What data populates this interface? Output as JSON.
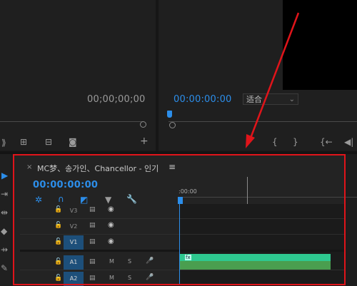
{
  "source_monitor": {
    "timecode": "00;00;00;00",
    "buttons": [
      "insert-icon",
      "overwrite-icon",
      "export-frame-icon",
      "add-icon"
    ]
  },
  "program_monitor": {
    "timecode": "00:00:00:00",
    "fit_label": "适合",
    "controls": [
      "mark-in-icon",
      "mark-out-icon",
      "go-to-in-icon",
      "step-back-icon"
    ]
  },
  "timeline": {
    "close": "×",
    "sequence_title": "MC梦、송가인、Chancellor - 인기",
    "menu": "≡",
    "timecode": "00:00:00:00",
    "ruler_label": ":00:00",
    "video_tracks": [
      {
        "name": "V3",
        "targeted": false
      },
      {
        "name": "V2",
        "targeted": false
      },
      {
        "name": "V1",
        "targeted": true
      }
    ],
    "audio_tracks": [
      {
        "name": "A1",
        "targeted": true,
        "m": "M",
        "s": "S"
      },
      {
        "name": "A2",
        "targeted": true,
        "m": "M",
        "s": "S"
      }
    ],
    "clip_fx": "fx"
  },
  "colors": {
    "accent_blue": "#2c8eea",
    "annotation_red": "#e0141a",
    "video_clip": "#2ec88f",
    "audio_clip": "#4a9e4f"
  }
}
